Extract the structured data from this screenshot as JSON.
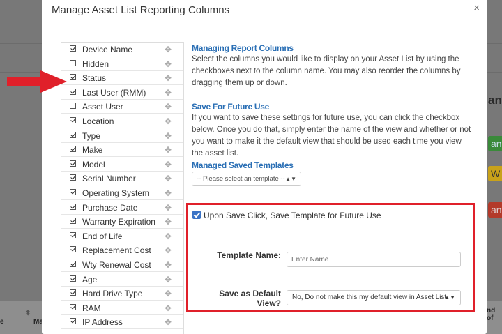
{
  "modal": {
    "title": "Manage Asset List Reporting Columns",
    "close_glyph": "×"
  },
  "columns": [
    {
      "label": "Device Name",
      "checked": true
    },
    {
      "label": "Hidden",
      "checked": false
    },
    {
      "label": "Status",
      "checked": true
    },
    {
      "label": "Last User (RMM)",
      "checked": true
    },
    {
      "label": "Asset User",
      "checked": false
    },
    {
      "label": "Location",
      "checked": true
    },
    {
      "label": "Type",
      "checked": true
    },
    {
      "label": "Make",
      "checked": true
    },
    {
      "label": "Model",
      "checked": true
    },
    {
      "label": "Serial Number",
      "checked": true
    },
    {
      "label": "Operating System",
      "checked": true
    },
    {
      "label": "Purchase Date",
      "checked": true
    },
    {
      "label": "Warranty Expiration",
      "checked": true
    },
    {
      "label": "End of Life",
      "checked": true
    },
    {
      "label": "Replacement Cost",
      "checked": true
    },
    {
      "label": "Wty Renewal Cost",
      "checked": true
    },
    {
      "label": "Age",
      "checked": true
    },
    {
      "label": "Hard Drive Type",
      "checked": true
    },
    {
      "label": "RAM",
      "checked": true
    },
    {
      "label": "IP Address",
      "checked": true
    }
  ],
  "drag_icon": "move-icon",
  "managing": {
    "title": "Managing Report Columns",
    "text": "Select the columns you would like to display on your Asset List by using the checkboxes next to the column name. You may also reorder the columns by dragging them up or down."
  },
  "future": {
    "title": "Save For Future Use",
    "text": "If you want to save these settings for future use, you can click the checkbox below. Once you do that, simply enter the name of the view and whether or not you want to make it the default view that should be used each time you view the asset list."
  },
  "templates": {
    "title": "Managed Saved Templates",
    "select_value": "-- Please select an template --"
  },
  "save_form": {
    "checkbox_label": "Upon Save Click, Save Template for Future Use",
    "checked": true,
    "name_label": "Template Name:",
    "name_placeholder": "Enter Name",
    "default_label": "Save as Default View?",
    "default_value": "No, Do not make this my default view in Asset List"
  },
  "background": {
    "heading_fragment": "ant",
    "badges": [
      "ant",
      "W",
      "ant"
    ],
    "footer_left": "e",
    "footer_mid": "Ma",
    "footer_right": "nd of"
  },
  "colors": {
    "accent_blue": "#2a6fb5",
    "highlight_red": "#e0202a",
    "arrow_red": "#e0202a"
  }
}
